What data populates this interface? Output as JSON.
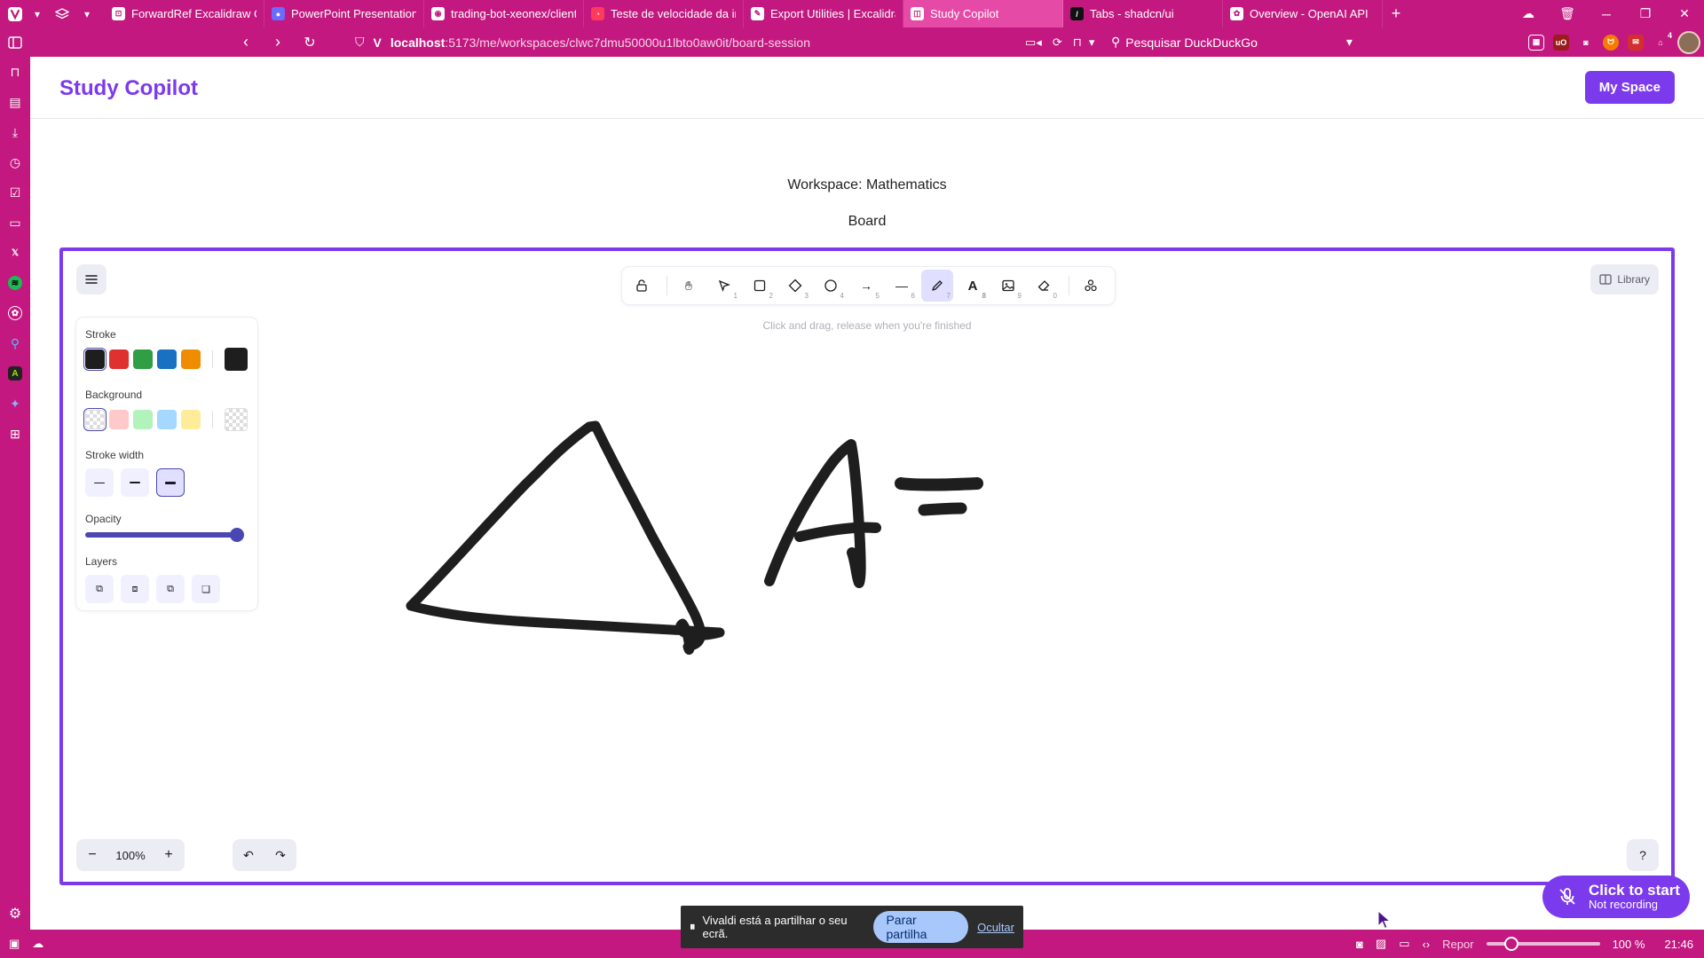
{
  "browser": {
    "tabs": [
      {
        "label": "ForwardRef Excalidraw Com",
        "fav_color": "#ffffff",
        "fav_text": "⊡",
        "active": false
      },
      {
        "label": "PowerPoint Presentation",
        "fav_color": "#6b6bff",
        "fav_text": "●",
        "active": false
      },
      {
        "label": "trading-bot-xeonex/client/s",
        "fav_color": "#ffffff",
        "fav_text": "◉",
        "active": false
      },
      {
        "label": "Teste de velocidade da inte",
        "fav_color": "#ff3b5c",
        "fav_text": "◔",
        "active": false
      },
      {
        "label": "Export Utilities | Excalidraw",
        "fav_color": "#ffffff",
        "fav_text": "✎",
        "active": false
      },
      {
        "label": "Study Copilot",
        "fav_color": "#ffffff",
        "fav_text": "◫",
        "active": true
      },
      {
        "label": "Tabs - shadcn/ui",
        "fav_color": "#111111",
        "fav_text": "/",
        "active": false
      },
      {
        "label": "Overview - OpenAI API",
        "fav_color": "#ffffff",
        "fav_text": "✿",
        "active": false
      }
    ],
    "url_host": "localhost",
    "url_rest": ":5173/me/workspaces/clwc7dmu50000u1lbto0aw0it/board-session",
    "search_placeholder": "Pesquisar DuckDuckGo",
    "extension_badge": "4"
  },
  "app": {
    "brand": "Study Copilot",
    "my_space_label": "My Space",
    "workspace_title": "Workspace: Mathematics",
    "board_title": "Board"
  },
  "excalidraw": {
    "hint": "Click and drag, release when you're finished",
    "library_label": "Library",
    "tool_numbers": [
      "1",
      "2",
      "3",
      "4",
      "5",
      "6",
      "7",
      "8",
      "9",
      "0"
    ],
    "props": {
      "stroke_label": "Stroke",
      "background_label": "Background",
      "stroke_width_label": "Stroke width",
      "opacity_label": "Opacity",
      "opacity_value": 1.0,
      "layers_label": "Layers",
      "stroke_colors": [
        "#1e1e1e",
        "#e03131",
        "#2f9e44",
        "#1971c2",
        "#f08c00"
      ],
      "stroke_current": "#1e1e1e",
      "background_colors": [
        "transparent",
        "#ffc9c9",
        "#b2f2bb",
        "#a5d8ff",
        "#ffec99"
      ]
    },
    "zoom_value": "100%"
  },
  "recording": {
    "title": "Click to start",
    "status": "Not recording"
  },
  "share_bar": {
    "message": "Vivaldi está a partilhar o seu ecrã.",
    "stop_label": "Parar partilha",
    "hide_label": "Ocultar"
  },
  "status_bar": {
    "reset_label": "Repor",
    "zoom": "100 %",
    "clock": "21:46"
  },
  "colors": {
    "browser_accent": "#c2187f",
    "brand_purple": "#7c3aed"
  }
}
